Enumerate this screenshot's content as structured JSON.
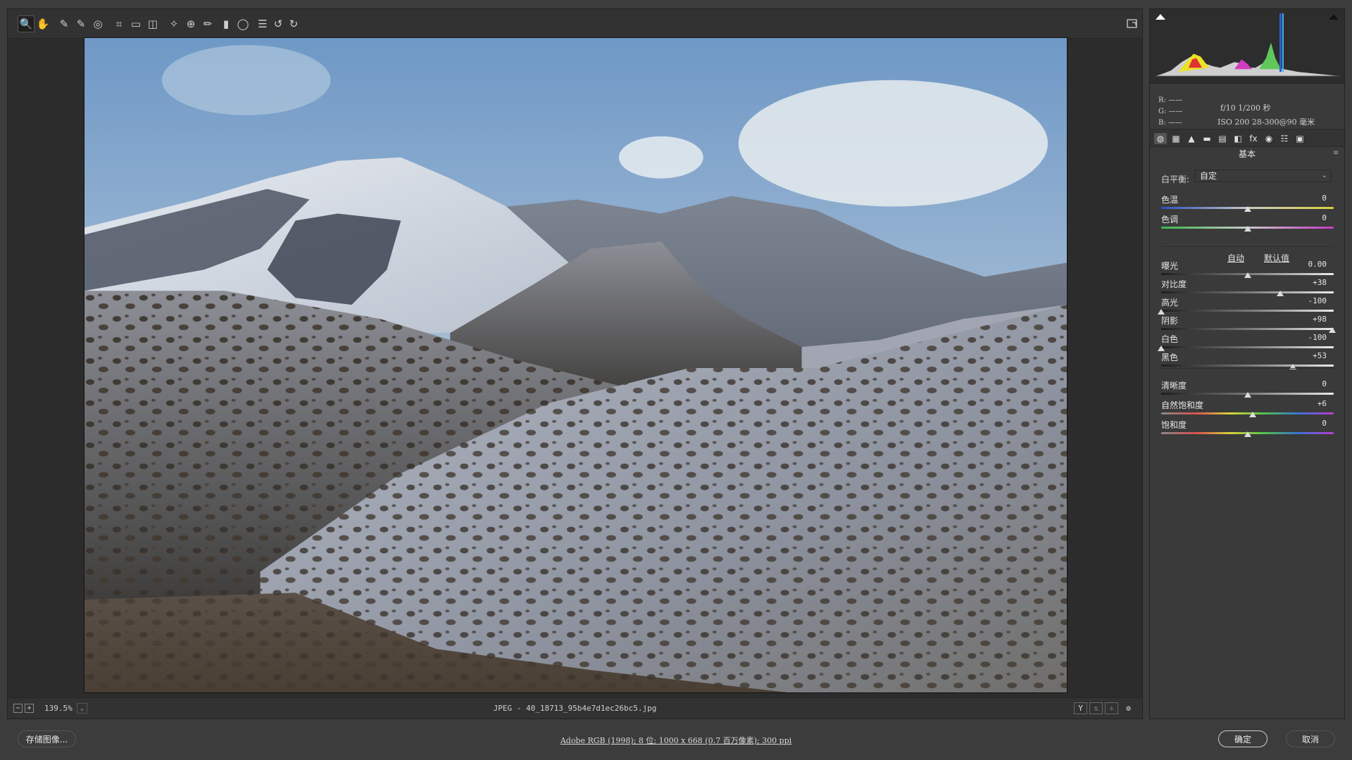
{
  "colors": {
    "background": "#3c3c3c",
    "editor_bg": "#2c2c2c",
    "panel_bg": "#3a3a3a",
    "text": "#d8d8d8"
  },
  "toolbar": {
    "tools": [
      {
        "name": "zoom-tool",
        "icon": "magnifier-icon",
        "glyph": "🔍"
      },
      {
        "name": "hand-tool",
        "icon": "hand-icon",
        "glyph": "✋"
      },
      {
        "name": "white-balance-tool",
        "icon": "eyedropper-icon",
        "glyph": "✎"
      },
      {
        "name": "color-sampler-tool",
        "icon": "color-sampler-icon",
        "glyph": "✎"
      },
      {
        "name": "targeted-adjustment-tool",
        "icon": "target-icon",
        "glyph": "◎"
      },
      {
        "name": "crop-tool",
        "icon": "crop-icon",
        "glyph": "⌗"
      },
      {
        "name": "straighten-tool",
        "icon": "ruler-icon",
        "glyph": "▭"
      },
      {
        "name": "transform-tool",
        "icon": "transform-icon",
        "glyph": "◫"
      },
      {
        "name": "spot-removal-tool",
        "icon": "spot-removal-icon",
        "glyph": "✧"
      },
      {
        "name": "red-eye-tool",
        "icon": "red-eye-icon",
        "glyph": "⊕"
      },
      {
        "name": "adjustment-brush-tool",
        "icon": "brush-icon",
        "glyph": "✏"
      },
      {
        "name": "graduated-filter-tool",
        "icon": "graduated-filter-icon",
        "glyph": "▮"
      },
      {
        "name": "radial-filter-tool",
        "icon": "radial-filter-icon",
        "glyph": "◯"
      },
      {
        "name": "preferences-tool",
        "icon": "list-icon",
        "glyph": "☰"
      },
      {
        "name": "rotate-left-tool",
        "icon": "rotate-ccw-icon",
        "glyph": "↺"
      },
      {
        "name": "rotate-right-tool",
        "icon": "rotate-cw-icon",
        "glyph": "↻"
      }
    ],
    "fullscreen_icon": "fullscreen-icon"
  },
  "status": {
    "zoom_out": "−",
    "zoom_in": "+",
    "zoom_level": "139.5%",
    "zoom_caret": "⌄",
    "file_info": "JPEG -  40_18713_95b4e7d1ec26bc5.jpg",
    "view_y": "Y",
    "view_before_after": "⇅",
    "view_swap": "✛",
    "view_settings": "⚙"
  },
  "panel": {
    "rgb": {
      "r": "R: ——",
      "g": "G: ——",
      "b": "B: ——"
    },
    "exif_line1": "f/10  1/200 秒",
    "exif_line2": "ISO 200  28-300@90 毫米",
    "tabs": [
      "◍",
      "▦",
      "▲",
      "▬",
      "▤",
      "◧",
      "fx",
      "◉",
      "☷",
      "▣"
    ],
    "title": "基本",
    "menu_glyph": "≡",
    "white_balance_label": "白平衡:",
    "white_balance_value": "自定",
    "auto_label": "自动",
    "default_label": "默认值",
    "sliders": [
      {
        "label": "色温",
        "value": "0",
        "position": 0.5,
        "gradient": "temp"
      },
      {
        "label": "色调",
        "value": "0",
        "position": 0.5,
        "gradient": "tint"
      },
      {
        "label": "曝光",
        "value": "0.00",
        "position": 0.5,
        "gradient": "gray"
      },
      {
        "label": "对比度",
        "value": "+38",
        "position": 0.69,
        "gradient": "gray"
      },
      {
        "label": "高光",
        "value": "-100",
        "position": 0.0,
        "gradient": "gray"
      },
      {
        "label": "阴影",
        "value": "+98",
        "position": 0.99,
        "gradient": "gray"
      },
      {
        "label": "白色",
        "value": "-100",
        "position": 0.0,
        "gradient": "gray"
      },
      {
        "label": "黑色",
        "value": "+53",
        "position": 0.765,
        "gradient": "gray"
      },
      {
        "label": "清晰度",
        "value": "0",
        "position": 0.5,
        "gradient": "gray"
      },
      {
        "label": "自然饱和度",
        "value": "+6",
        "position": 0.53,
        "gradient": "sat"
      },
      {
        "label": "饱和度",
        "value": "0",
        "position": 0.5,
        "gradient": "sat"
      }
    ]
  },
  "bottom": {
    "save_label": "存储图像...",
    "workflow_text": "Adobe RGB (1998); 8 位; 1000 x 668 (0.7 百万像素); 300 ppi",
    "ok_label": "确定",
    "cancel_label": "取消"
  }
}
